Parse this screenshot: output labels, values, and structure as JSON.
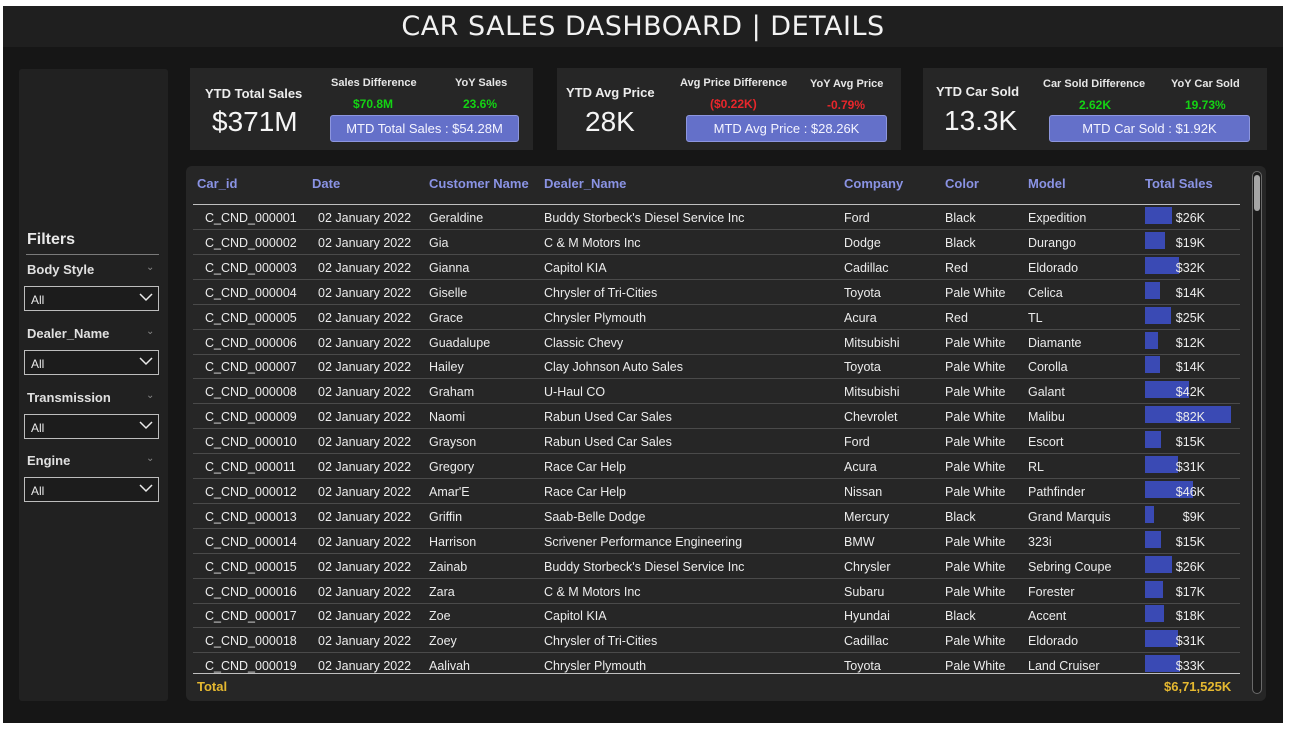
{
  "page": {
    "title": "CAR SALES DASHBOARD | DETAILS"
  },
  "filters": {
    "heading": "Filters",
    "items": [
      {
        "label": "Body Style",
        "value": "All"
      },
      {
        "label": "Dealer_Name",
        "value": "All"
      },
      {
        "label": "Transmission",
        "value": "All"
      },
      {
        "label": "Engine",
        "value": "All"
      }
    ]
  },
  "kpis": {
    "sales": {
      "label": "YTD Total Sales",
      "value": "$371M",
      "diff_label": "Sales Difference",
      "diff_value": "$70.8M",
      "yoy_label": "YoY Sales",
      "yoy_value": "23.6%",
      "mtd": "MTD Total Sales : $54.28M"
    },
    "avg_price": {
      "label": "YTD Avg Price",
      "value": "28K",
      "diff_label": "Avg Price Difference",
      "diff_value": "($0.22K)",
      "yoy_label": "YoY Avg Price",
      "yoy_value": "-0.79%",
      "mtd": "MTD Avg Price : $28.26K"
    },
    "cars_sold": {
      "label": "YTD Car Sold",
      "value": "13.3K",
      "diff_label": "Car Sold Difference",
      "diff_value": "2.62K",
      "yoy_label": "YoY Car Sold",
      "yoy_value": "19.73%",
      "mtd": "MTD Car Sold : $1.92K"
    }
  },
  "colors": {
    "positive": "#14d314",
    "negative": "#e8262b",
    "accent": "#6470c9",
    "bar": "#3a4ab4",
    "total": "#e5b830"
  },
  "table": {
    "columns": [
      "Car_id",
      "Date",
      "Customer Name",
      "Dealer_Name",
      "Company",
      "Color",
      "Model",
      "Total Sales"
    ],
    "rows": [
      {
        "car_id": "C_CND_000001",
        "date": "02 January 2022",
        "customer": "Geraldine",
        "dealer": "Buddy Storbeck's Diesel Service Inc",
        "company": "Ford",
        "color": "Black",
        "model": "Expedition",
        "sales": "$26K",
        "sales_k": 26
      },
      {
        "car_id": "C_CND_000002",
        "date": "02 January 2022",
        "customer": "Gia",
        "dealer": "C & M Motors Inc",
        "company": "Dodge",
        "color": "Black",
        "model": "Durango",
        "sales": "$19K",
        "sales_k": 19
      },
      {
        "car_id": "C_CND_000003",
        "date": "02 January 2022",
        "customer": "Gianna",
        "dealer": "Capitol KIA",
        "company": "Cadillac",
        "color": "Red",
        "model": "Eldorado",
        "sales": "$32K",
        "sales_k": 32
      },
      {
        "car_id": "C_CND_000004",
        "date": "02 January 2022",
        "customer": "Giselle",
        "dealer": "Chrysler of Tri-Cities",
        "company": "Toyota",
        "color": "Pale White",
        "model": "Celica",
        "sales": "$14K",
        "sales_k": 14
      },
      {
        "car_id": "C_CND_000005",
        "date": "02 January 2022",
        "customer": "Grace",
        "dealer": "Chrysler Plymouth",
        "company": "Acura",
        "color": "Red",
        "model": "TL",
        "sales": "$25K",
        "sales_k": 25
      },
      {
        "car_id": "C_CND_000006",
        "date": "02 January 2022",
        "customer": "Guadalupe",
        "dealer": "Classic Chevy",
        "company": "Mitsubishi",
        "color": "Pale White",
        "model": "Diamante",
        "sales": "$12K",
        "sales_k": 12
      },
      {
        "car_id": "C_CND_000007",
        "date": "02 January 2022",
        "customer": "Hailey",
        "dealer": "Clay Johnson Auto Sales",
        "company": "Toyota",
        "color": "Pale White",
        "model": "Corolla",
        "sales": "$14K",
        "sales_k": 14
      },
      {
        "car_id": "C_CND_000008",
        "date": "02 January 2022",
        "customer": "Graham",
        "dealer": "U-Haul CO",
        "company": "Mitsubishi",
        "color": "Pale White",
        "model": "Galant",
        "sales": "$42K",
        "sales_k": 42
      },
      {
        "car_id": "C_CND_000009",
        "date": "02 January 2022",
        "customer": "Naomi",
        "dealer": "Rabun Used Car Sales",
        "company": "Chevrolet",
        "color": "Pale White",
        "model": "Malibu",
        "sales": "$82K",
        "sales_k": 82
      },
      {
        "car_id": "C_CND_000010",
        "date": "02 January 2022",
        "customer": "Grayson",
        "dealer": "Rabun Used Car Sales",
        "company": "Ford",
        "color": "Pale White",
        "model": "Escort",
        "sales": "$15K",
        "sales_k": 15
      },
      {
        "car_id": "C_CND_000011",
        "date": "02 January 2022",
        "customer": "Gregory",
        "dealer": "Race Car Help",
        "company": "Acura",
        "color": "Pale White",
        "model": "RL",
        "sales": "$31K",
        "sales_k": 31
      },
      {
        "car_id": "C_CND_000012",
        "date": "02 January 2022",
        "customer": "Amar'E",
        "dealer": "Race Car Help",
        "company": "Nissan",
        "color": "Pale White",
        "model": "Pathfinder",
        "sales": "$46K",
        "sales_k": 46
      },
      {
        "car_id": "C_CND_000013",
        "date": "02 January 2022",
        "customer": "Griffin",
        "dealer": "Saab-Belle Dodge",
        "company": "Mercury",
        "color": "Black",
        "model": "Grand Marquis",
        "sales": "$9K",
        "sales_k": 9
      },
      {
        "car_id": "C_CND_000014",
        "date": "02 January 2022",
        "customer": "Harrison",
        "dealer": "Scrivener Performance Engineering",
        "company": "BMW",
        "color": "Pale White",
        "model": "323i",
        "sales": "$15K",
        "sales_k": 15
      },
      {
        "car_id": "C_CND_000015",
        "date": "02 January 2022",
        "customer": "Zainab",
        "dealer": "Buddy Storbeck's Diesel Service Inc",
        "company": "Chrysler",
        "color": "Pale White",
        "model": "Sebring Coupe",
        "sales": "$26K",
        "sales_k": 26
      },
      {
        "car_id": "C_CND_000016",
        "date": "02 January 2022",
        "customer": "Zara",
        "dealer": "C & M Motors Inc",
        "company": "Subaru",
        "color": "Pale White",
        "model": "Forester",
        "sales": "$17K",
        "sales_k": 17
      },
      {
        "car_id": "C_CND_000017",
        "date": "02 January 2022",
        "customer": "Zoe",
        "dealer": "Capitol KIA",
        "company": "Hyundai",
        "color": "Black",
        "model": "Accent",
        "sales": "$18K",
        "sales_k": 18
      },
      {
        "car_id": "C_CND_000018",
        "date": "02 January 2022",
        "customer": "Zoey",
        "dealer": "Chrysler of Tri-Cities",
        "company": "Cadillac",
        "color": "Pale White",
        "model": "Eldorado",
        "sales": "$31K",
        "sales_k": 31
      },
      {
        "car_id": "C_CND_000019",
        "date": "02 January 2022",
        "customer": "Aalivah",
        "dealer": "Chrysler Plymouth",
        "company": "Toyota",
        "color": "Pale White",
        "model": "Land Cruiser",
        "sales": "$33K",
        "sales_k": 33
      }
    ],
    "total_label": "Total",
    "total_value": "$6,71,525K"
  }
}
